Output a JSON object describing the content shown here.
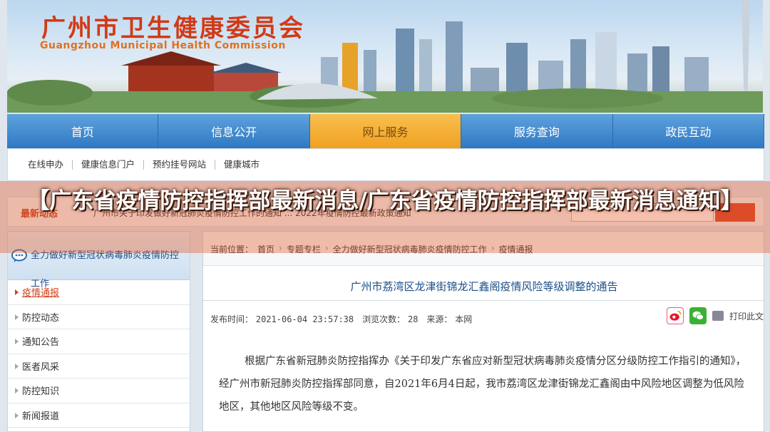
{
  "banner": {
    "title": "广州市卫生健康委员会",
    "subtitle": "Guangzhou Municipal Health Commission"
  },
  "nav": {
    "items": [
      {
        "label": "首页",
        "active": false
      },
      {
        "label": "信息公开",
        "active": false
      },
      {
        "label": "网上服务",
        "active": true
      },
      {
        "label": "服务查询",
        "active": false
      },
      {
        "label": "政民互动",
        "active": false
      }
    ]
  },
  "subnav": {
    "items": [
      "在线申办",
      "健康信息门户",
      "预约挂号网站",
      "健康城市"
    ]
  },
  "news_strip": {
    "label": "最新动态",
    "text": "广州市关于印发做好新冠肺炎疫情防控工作的通知 ... 2022年疫情防控最新政策通知"
  },
  "sidebar": {
    "heading": "全力做好新型冠状病毒肺炎疫情防控工作",
    "items": [
      {
        "label": "疫情通报",
        "active": true
      },
      {
        "label": "防控动态",
        "active": false
      },
      {
        "label": "通知公告",
        "active": false
      },
      {
        "label": "医者风采",
        "active": false
      },
      {
        "label": "防控知识",
        "active": false
      },
      {
        "label": "新闻报道",
        "active": false
      }
    ]
  },
  "breadcrumb": {
    "prefix": "当前位置：",
    "items": [
      "首页",
      "专题专栏",
      "全力做好新型冠状病毒肺炎疫情防控工作",
      "疫情通报"
    ]
  },
  "article": {
    "title": "广州市荔湾区龙津街锦龙汇鑫阁疫情风险等级调整的通告",
    "publish_label": "发布时间：",
    "publish_time": "2021-06-04 23:57:38",
    "views_label": "浏览次数：",
    "views": "28",
    "source_label": "来源：",
    "source": "本网",
    "print_label": "打印此文",
    "body": "根据广东省新冠肺炎防控指挥办《关于印发广东省应对新型冠状病毒肺炎疫情分区分级防控工作指引的通知》，经广州市新冠肺炎防控指挥部同意，自2021年6月4日起，我市荔湾区龙津街锦龙汇鑫阁由中风险地区调整为低风险地区，其他地区风险等级不变。"
  },
  "overlay": {
    "headline": "【广东省疫情防控指挥部最新消息/广东省疫情防控指挥部最新消息通知】"
  },
  "colors": {
    "nav_blue": "#2f78c4",
    "nav_active": "#f0a021",
    "banner_red": "#d23a16",
    "overlay": "#e65a28"
  },
  "icons": [
    "chat-bubble-icon",
    "weibo-icon",
    "wechat-icon",
    "print-icon"
  ]
}
